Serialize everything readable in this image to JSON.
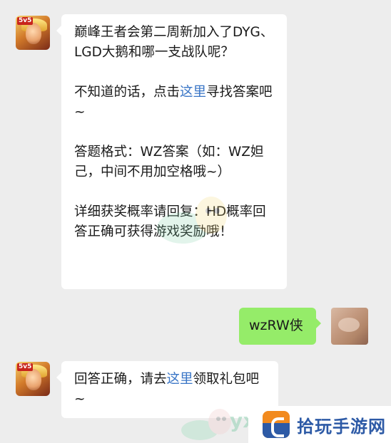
{
  "messages": {
    "m1": {
      "p1": "巅峰王者会第二周新加入了DYG、LGD大鹅和哪一支战队呢？",
      "p2_pre": "不知道的话，点击",
      "p2_link": "这里",
      "p2_post": "寻找答案吧~",
      "p3": "答题格式：WZ答案（如：WZ妲己，中间不用加空格哦~）",
      "p4": "详细获奖概率请回复：HD概率回答正确可获得游戏奖励哦！"
    },
    "m2": {
      "text": "wzRW侠"
    },
    "m3": {
      "pre": "回答正确，请去",
      "link": "这里",
      "post": "领取礼包吧~"
    }
  },
  "game_avatar_logo": "5v5",
  "watermark_text": "yx",
  "brand": {
    "name": "拾玩手游网"
  },
  "colors": {
    "background": "#ededed",
    "bubble_in": "#ffffff",
    "bubble_out": "#95ec69",
    "link": "#3975c6",
    "brand_blue": "#2d5aa6",
    "brand_orange": "#f28a1e"
  }
}
